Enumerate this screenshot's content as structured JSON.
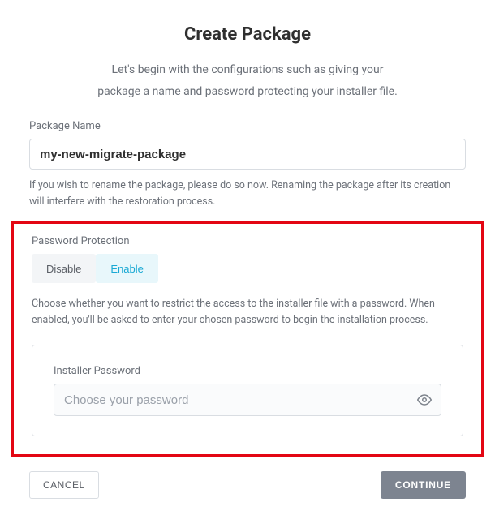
{
  "header": {
    "title": "Create Package",
    "intro_line1": "Let's begin with the configurations such as giving your",
    "intro_line2": "package a name and password protecting your installer file."
  },
  "package": {
    "label": "Package Name",
    "value": "my-new-migrate-package",
    "help": "If you wish to rename the package, please do so now. Renaming the package after its creation will interfere with the restoration process."
  },
  "password_protection": {
    "label": "Password Protection",
    "disable_label": "Disable",
    "enable_label": "Enable",
    "help": "Choose whether you want to restrict the access to the installer file with a password. When enabled, you'll be asked to enter your chosen password to begin the installation process.",
    "installer_label": "Installer Password",
    "installer_placeholder": "Choose your password"
  },
  "footer": {
    "cancel": "CANCEL",
    "continue": "CONTINUE"
  }
}
